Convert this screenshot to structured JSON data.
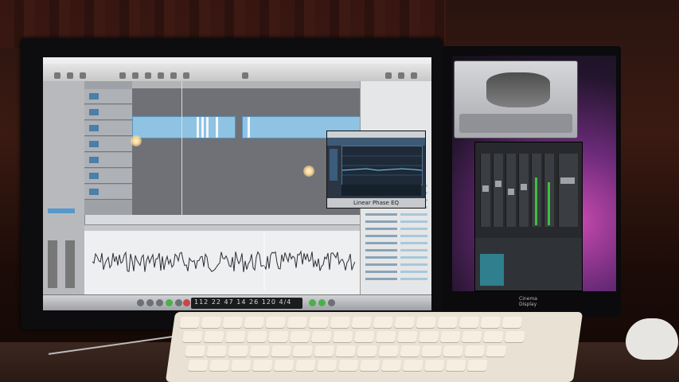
{
  "scene": {
    "description_tag": "photo of a music production desk",
    "main_monitor": {
      "app": "audio workstation",
      "plugin_window_title": "Linear Phase EQ",
      "transport_readout": "112  22  47  14  26  120  4/4",
      "right_panel_items": 14
    },
    "second_monitor": {
      "windows": [
        "synth-plugin",
        "mixer"
      ],
      "brand_label": "Cinema Display"
    }
  },
  "colors": {
    "region_blue": "#8ec3e4",
    "wallpaper_magenta": "#c84ab0",
    "room_red": "#3a1a12"
  }
}
